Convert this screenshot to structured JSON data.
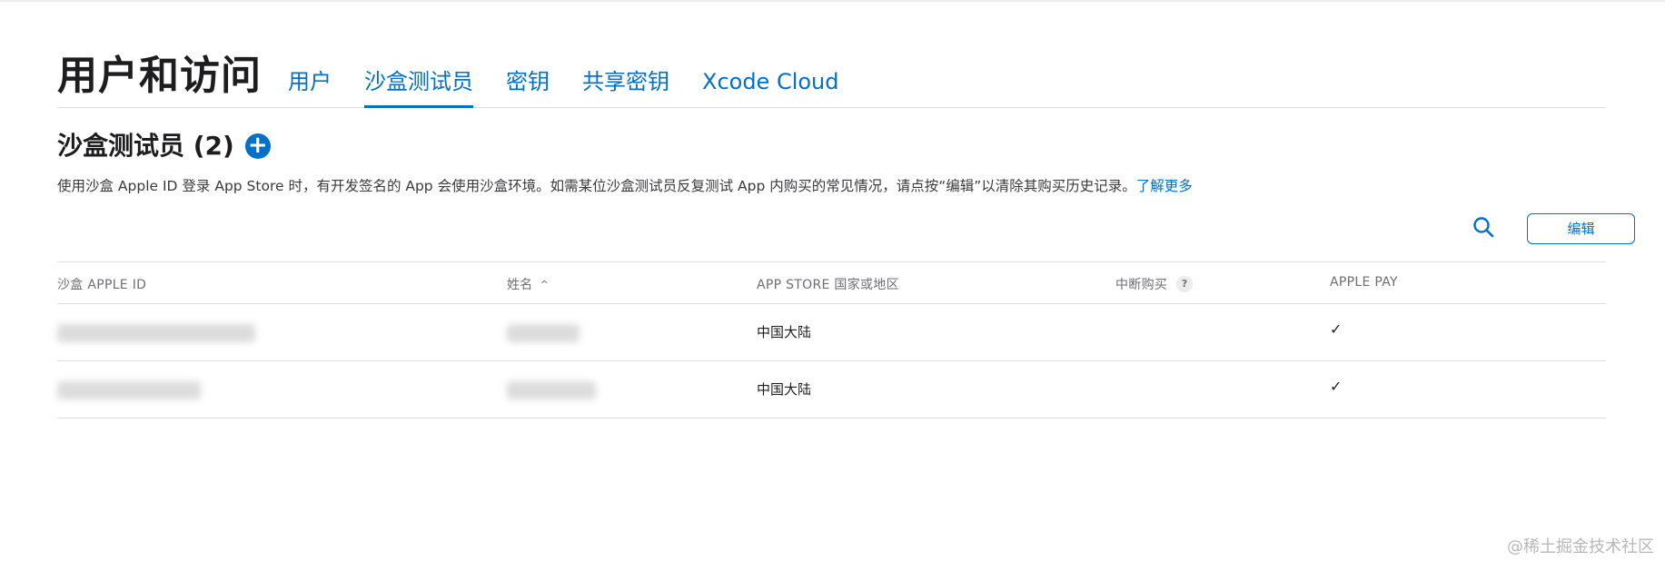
{
  "header": {
    "title": "用户和访问",
    "tabs": [
      {
        "label": "用户",
        "active": false
      },
      {
        "label": "沙盒测试员",
        "active": true
      },
      {
        "label": "密钥",
        "active": false
      },
      {
        "label": "共享密钥",
        "active": false
      },
      {
        "label": "Xcode Cloud",
        "active": false
      }
    ]
  },
  "section": {
    "title": "沙盒测试员 (2)",
    "add_icon": "plus-circle-icon",
    "description": "使用沙盒 Apple ID 登录 App Store 时，有开发签名的 App 会使用沙盒环境。如需某位沙盒测试员反复测试 App 内购买的常见情况，请点按“编辑”以清除其购买历史记录。",
    "learn_more": "了解更多"
  },
  "toolbar": {
    "search_icon": "search-icon",
    "edit_label": "编辑"
  },
  "table": {
    "columns": [
      "沙盒 APPLE ID",
      "姓名",
      "APP STORE 国家或地区",
      "中断购买",
      "APPLE PAY"
    ],
    "help_label": "?",
    "rows": [
      {
        "apple_id": "",
        "name": "",
        "region": "中国大陆",
        "interrupt": false,
        "apple_pay": "✓"
      },
      {
        "apple_id": "",
        "name": "",
        "region": "中国大陆",
        "interrupt": false,
        "apple_pay": "✓"
      }
    ]
  },
  "colors": {
    "accent": "#0070c9",
    "text": "#1d1d1f",
    "muted": "#6e6e73",
    "border": "#dedede"
  },
  "watermark": "@稀土掘金技术社区"
}
